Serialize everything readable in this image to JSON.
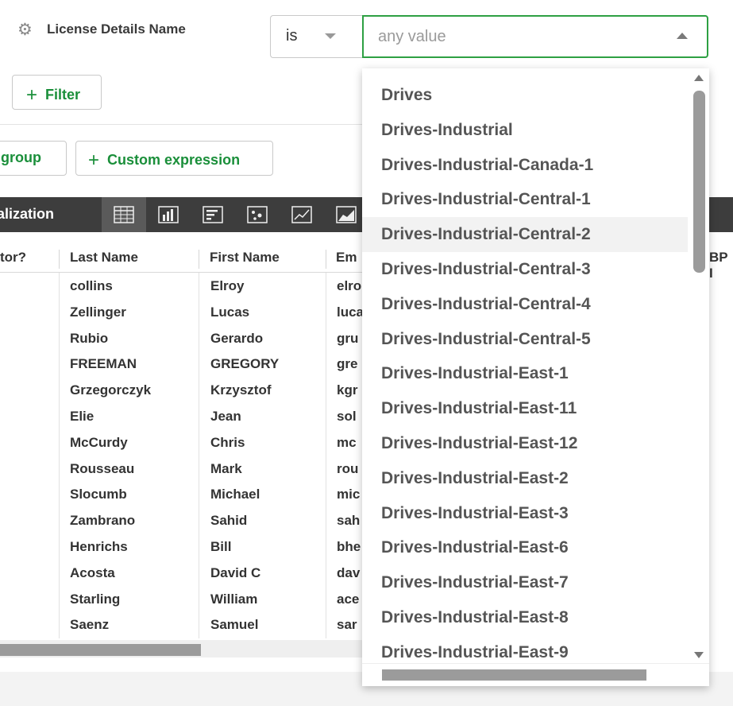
{
  "filter": {
    "field_label": "License Details Name",
    "operator_value": "is",
    "value_placeholder": "any value",
    "icon": "gear-icon"
  },
  "buttons": {
    "add_filter": "Filter",
    "add_group": "group",
    "custom_expression": "Custom expression"
  },
  "visualization": {
    "label": "alization",
    "icons": [
      "table-icon",
      "bar-chart-icon",
      "column-list-icon",
      "scatter-icon",
      "line-chart-icon",
      "area-chart-icon"
    ]
  },
  "table": {
    "columns": [
      "tor?",
      "Last Name",
      "First Name",
      "Em"
    ],
    "rows": [
      {
        "last": "collins",
        "first": "Elroy",
        "email": "elro"
      },
      {
        "last": "Zellinger",
        "first": "Lucas",
        "email": "luca"
      },
      {
        "last": "Rubio",
        "first": "Gerardo",
        "email": "gru"
      },
      {
        "last": "FREEMAN",
        "first": "GREGORY",
        "email": "gre"
      },
      {
        "last": "Grzegorczyk",
        "first": "Krzysztof",
        "email": "kgr"
      },
      {
        "last": "Elie",
        "first": "Jean",
        "email": "sol"
      },
      {
        "last": "McCurdy",
        "first": "Chris",
        "email": "mc"
      },
      {
        "last": "Rousseau",
        "first": "Mark",
        "email": "rou"
      },
      {
        "last": "Slocumb",
        "first": "Michael",
        "email": "mic"
      },
      {
        "last": "Zambrano",
        "first": "Sahid",
        "email": "sah"
      },
      {
        "last": "Henrichs",
        "first": "Bill",
        "email": "bhe"
      },
      {
        "last": "Acosta",
        "first": "David C",
        "email": "dav"
      },
      {
        "last": "Starling",
        "first": "William",
        "email": "ace"
      },
      {
        "last": "Saenz",
        "first": "Samuel",
        "email": "sar"
      }
    ],
    "right_fragment": "BP I"
  },
  "dropdown": {
    "options": [
      "Drives",
      "Drives-Industrial",
      "Drives-Industrial-Canada-1",
      "Drives-Industrial-Central-1",
      "Drives-Industrial-Central-2",
      "Drives-Industrial-Central-3",
      "Drives-Industrial-Central-4",
      "Drives-Industrial-Central-5",
      "Drives-Industrial-East-1",
      "Drives-Industrial-East-11",
      "Drives-Industrial-East-12",
      "Drives-Industrial-East-2",
      "Drives-Industrial-East-3",
      "Drives-Industrial-East-6",
      "Drives-Industrial-East-7",
      "Drives-Industrial-East-8",
      "Drives-Industrial-East-9"
    ],
    "hovered_option": "Drives-Industrial-Central-2"
  },
  "colors": {
    "accent_green": "#1a8f3a",
    "focus_border": "#2ea043",
    "viz_bar": "#3d3d3d"
  }
}
